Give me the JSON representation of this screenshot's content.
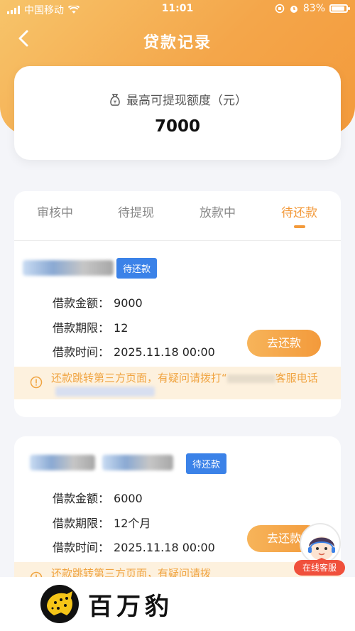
{
  "status_bar": {
    "carrier": "中国移动",
    "time": "11:01",
    "battery": "83%"
  },
  "nav": {
    "title": "贷款记录"
  },
  "quota": {
    "label": "最高可提现额度（元）",
    "value": "7000"
  },
  "tabs": [
    {
      "label": "审核中"
    },
    {
      "label": "待提现"
    },
    {
      "label": "放款中"
    },
    {
      "label": "待还款"
    }
  ],
  "active_tab": "待还款",
  "loans": [
    {
      "status": "待还款",
      "amount_label": "借款金额：",
      "amount": "9000",
      "term_label": "借款期限：",
      "term": "12",
      "time_label": "借款时间：",
      "time": "2025.11.18 00:00",
      "action": "去还款",
      "notice_text": "还款跳转第三方页面，有疑问请拨打“",
      "notice_text_2": "客服电话"
    },
    {
      "status": "待还款",
      "amount_label": "借款金额：",
      "amount": "6000",
      "term_label": "借款期限：",
      "term": "12个月",
      "time_label": "借款时间：",
      "time": "2025.11.18 00:00",
      "action": "去还款",
      "notice_text": "还款跳转第三方页面，有疑问请拨"
    }
  ],
  "service": {
    "label": "在线客服"
  },
  "brand": {
    "name": "百万豹"
  },
  "colors": {
    "accent": "#f39a3b",
    "badge": "#3b82e8",
    "notice_bg": "#fdf1de",
    "service_red": "#f0503c"
  }
}
